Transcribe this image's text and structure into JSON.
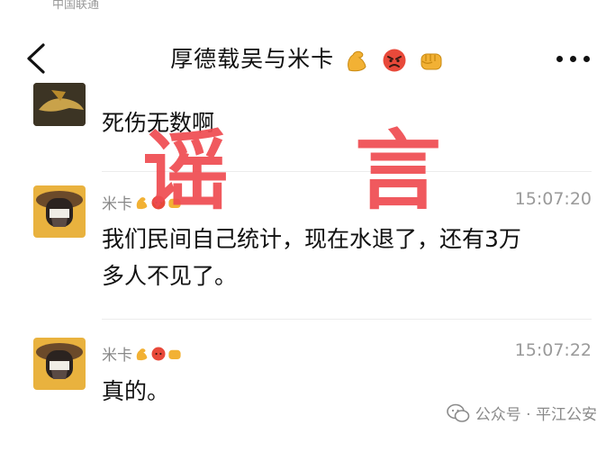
{
  "status_fragment": "中国联通",
  "header": {
    "title": "厚德载吴与米卡",
    "title_emoji": [
      "flexed-biceps-emoji",
      "angry-face-emoji",
      "fist-emoji"
    ]
  },
  "messages": [
    {
      "text": "死伤无数啊"
    },
    {
      "sender": "米卡",
      "time": "15:07:20",
      "text_line1": "我们民间自己统计，现在水退了，还有3万",
      "text_line2": "多人不见了。"
    },
    {
      "sender": "米卡",
      "time": "15:07:22",
      "text_line1": "真的。"
    }
  ],
  "stamp": {
    "char1": "谣",
    "char2": "言"
  },
  "watermark": {
    "text": "公众号 · 平江公安"
  },
  "colors": {
    "stamp": "#ef4c51",
    "muted": "#9a9a9a",
    "text": "#111111"
  }
}
